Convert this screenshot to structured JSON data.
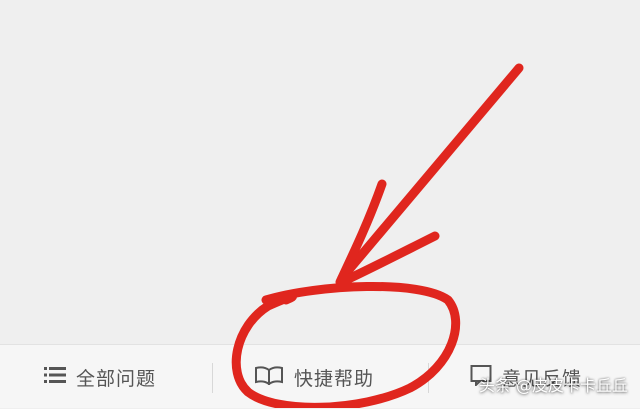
{
  "bottom_bar": {
    "tabs": [
      {
        "label": "全部问题",
        "icon": "list-icon"
      },
      {
        "label": "快捷帮助",
        "icon": "book-icon"
      },
      {
        "label": "意见反馈",
        "icon": "message-icon"
      }
    ]
  },
  "watermark": {
    "platform": "头条",
    "author": "@皮皮卡卡丘丘"
  },
  "colors": {
    "annotation": "#e0261e",
    "bar_background": "#f6f6f6",
    "page_background": "#efefef",
    "tab_text": "#555555"
  }
}
